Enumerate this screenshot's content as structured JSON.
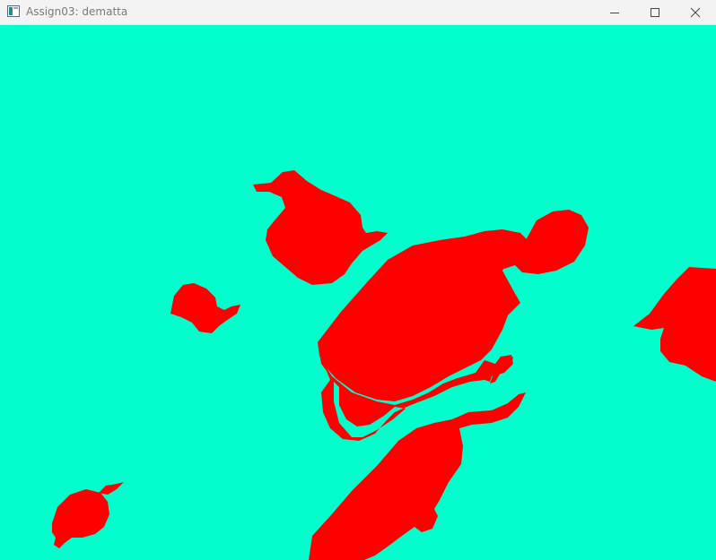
{
  "window": {
    "title": "Assign03: dematta",
    "icons": {
      "app": "app-window-icon",
      "minimize": "minimize-icon",
      "maximize": "maximize-icon",
      "close": "close-icon"
    }
  },
  "scene": {
    "background_color": "#00ffcc",
    "shape_color": "#ff0000",
    "shapes": [
      "teapot",
      "teapot",
      "teapot",
      "teapot",
      "teapot",
      "teapot",
      "teapot",
      "teapot"
    ]
  }
}
